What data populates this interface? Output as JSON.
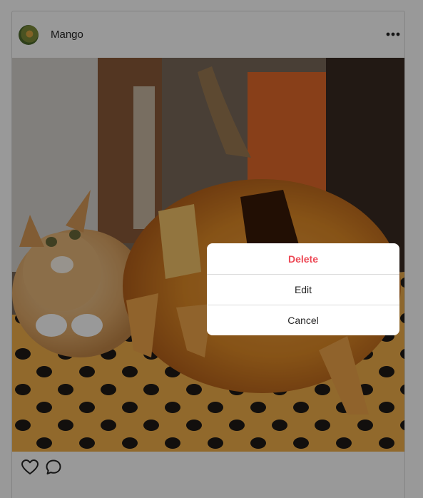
{
  "post": {
    "username": "Mango",
    "more_icon": "more-horizontal-icon",
    "photo_description": "",
    "actions": {
      "like_icon": "heart-outline-icon",
      "comment_icon": "speech-bubble-icon"
    }
  },
  "menu": {
    "delete_label": "Delete",
    "edit_label": "Edit",
    "cancel_label": "Cancel"
  },
  "colors": {
    "danger": "#ed4956",
    "text": "#262626",
    "border": "#dbdbdb",
    "overlay": "rgba(0,0,0,0.40)"
  }
}
